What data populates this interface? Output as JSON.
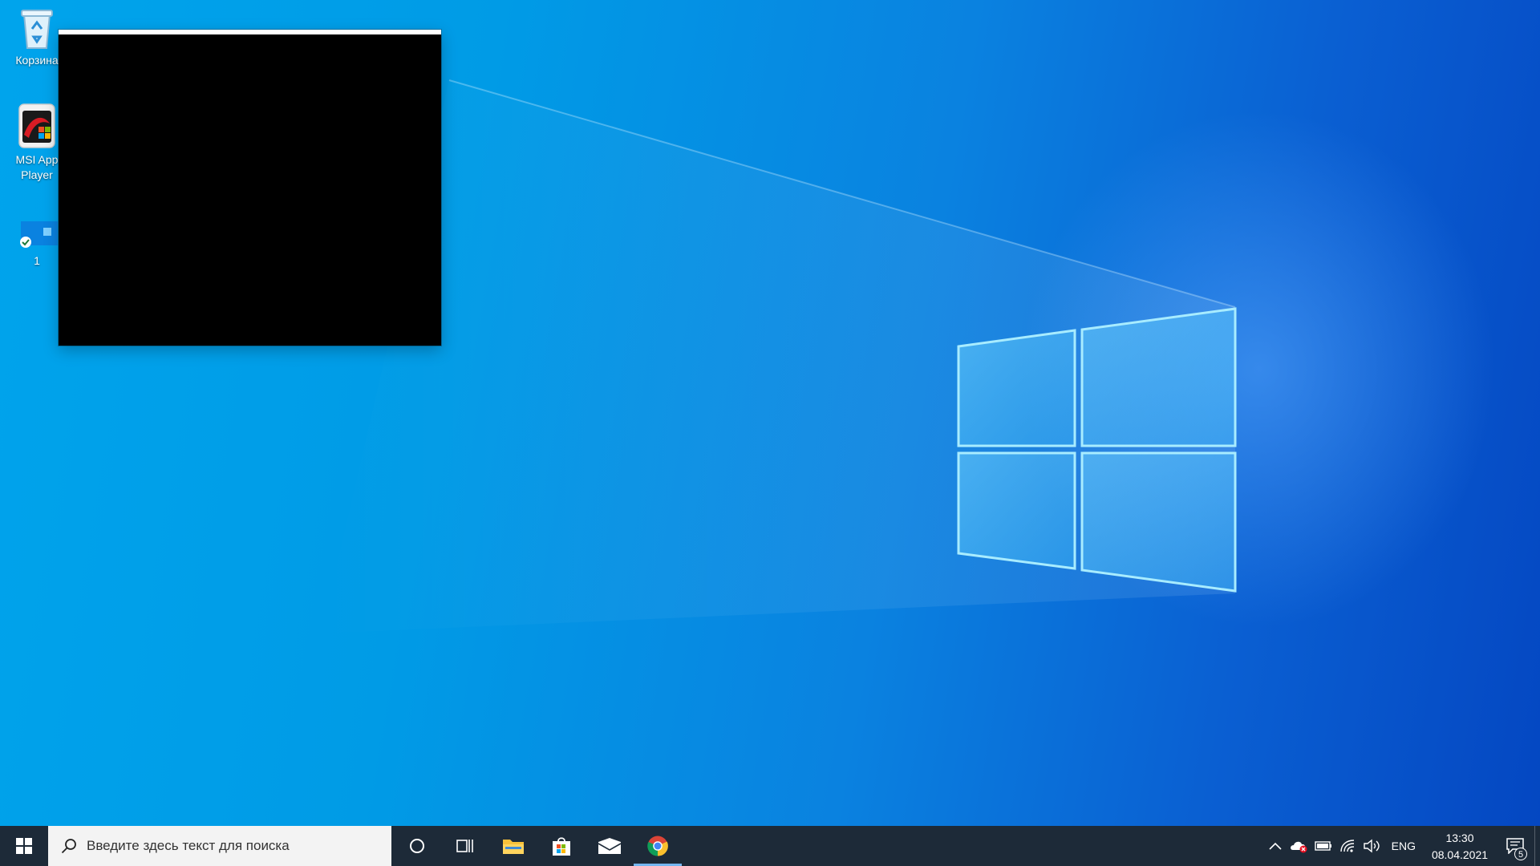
{
  "desktop": {
    "icons": [
      {
        "label": "Корзина",
        "icon": "recycle-bin-icon"
      },
      {
        "label": "MSI App Player",
        "icon": "msi-app-player-icon"
      },
      {
        "label": "1",
        "icon": "file-thumbnail-icon"
      }
    ]
  },
  "taskbar": {
    "search_placeholder": "Введите здесь текст для поиска",
    "apps": [
      {
        "name": "cortana",
        "icon": "cortana-circle-icon"
      },
      {
        "name": "task-view",
        "icon": "task-view-icon"
      },
      {
        "name": "file-explorer",
        "icon": "folder-icon"
      },
      {
        "name": "microsoft-store",
        "icon": "store-bag-icon"
      },
      {
        "name": "mail",
        "icon": "mail-envelope-icon"
      },
      {
        "name": "chrome",
        "icon": "chrome-icon",
        "active": true
      }
    ],
    "tray": {
      "language": "ENG",
      "time": "13:30",
      "date": "08.04.2021",
      "notification_count": "5"
    }
  },
  "colors": {
    "taskbar_bg": "#1d2a38",
    "active_indicator": "#74b6f0",
    "desktop_accent": "#0a82e0"
  }
}
